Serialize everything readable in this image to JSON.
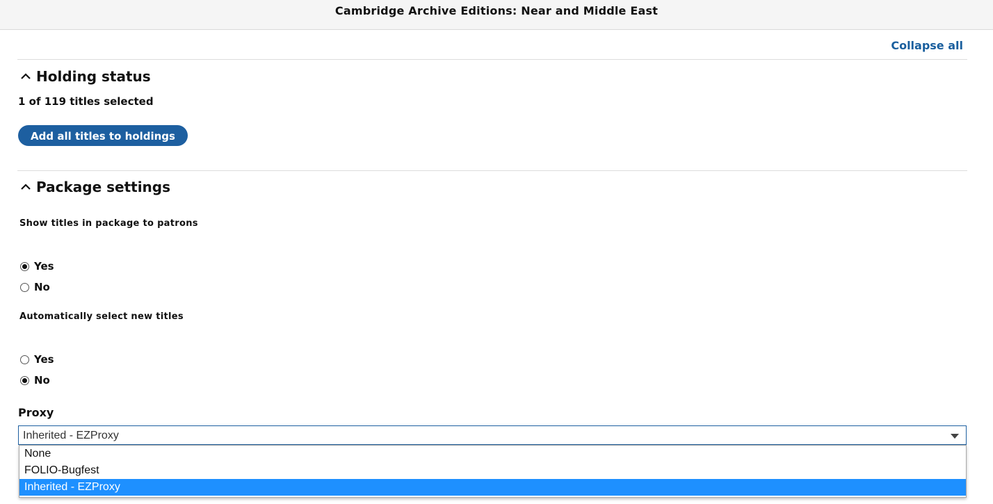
{
  "header": {
    "title": "Cambridge Archive Editions: Near and Middle East"
  },
  "actions": {
    "collapse_all": "Collapse all"
  },
  "holding_status": {
    "heading": "Holding status",
    "selected_text": "1 of 119 titles selected",
    "add_button": "Add all titles to holdings"
  },
  "package_settings": {
    "heading": "Package settings",
    "show_titles": {
      "label": "Show titles in package to patrons",
      "options": [
        {
          "label": "Yes",
          "checked": true
        },
        {
          "label": "No",
          "checked": false
        }
      ]
    },
    "auto_select": {
      "label": "Automatically select new titles",
      "options": [
        {
          "label": "Yes",
          "checked": false
        },
        {
          "label": "No",
          "checked": true
        }
      ]
    },
    "proxy": {
      "label": "Proxy",
      "value": "Inherited - EZProxy",
      "options": [
        "None",
        "FOLIO-Bugfest",
        "Inherited - EZProxy"
      ]
    }
  },
  "colors": {
    "accent": "#1d5fa0",
    "highlight": "#1e90ff"
  },
  "icons": {
    "section_toggle": "chevron-up-icon",
    "select_caret": "caret-down-icon"
  }
}
